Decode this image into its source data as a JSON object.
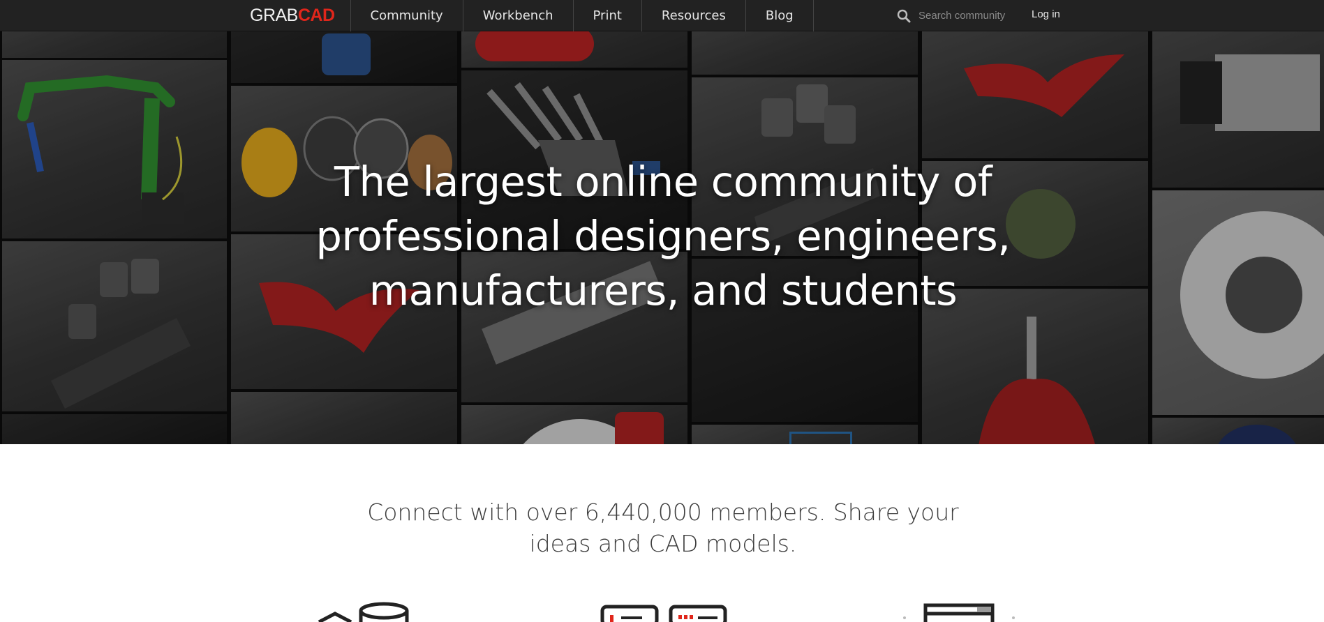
{
  "nav": {
    "logo_part1": "GRAB",
    "logo_part2": "CAD",
    "items": [
      {
        "label": "Community"
      },
      {
        "label": "Workbench"
      },
      {
        "label": "Print"
      },
      {
        "label": "Resources"
      },
      {
        "label": "Blog"
      }
    ],
    "search_placeholder": "Search community",
    "login_label": "Log in"
  },
  "hero": {
    "title": "The largest online community of professional designers, engineers, manufacturers, and students"
  },
  "intro": {
    "text": "Connect with over 6,440,000 members. Share your ideas and CAD models."
  },
  "icons": {
    "search": "search-icon",
    "features": [
      "cad-models-icon",
      "workbench-icon",
      "print-icon"
    ]
  },
  "colors": {
    "nav_bg": "#222222",
    "brand_red": "#e0261b",
    "hero_text": "#ffffff",
    "body_text": "#3d3d3d"
  }
}
